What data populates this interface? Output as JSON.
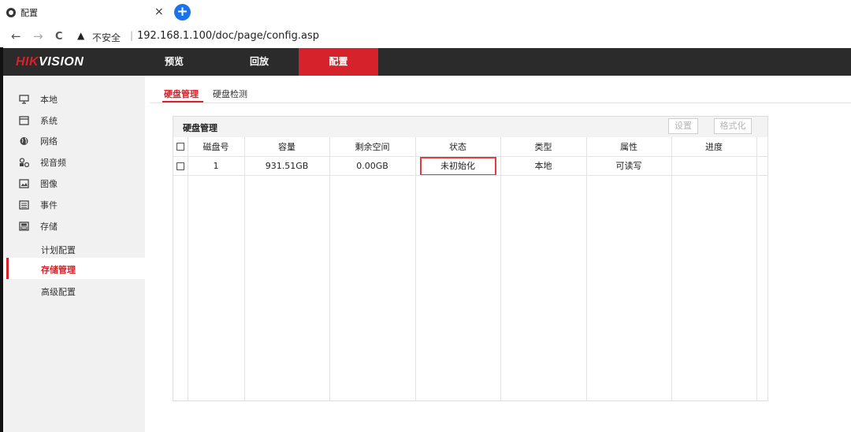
{
  "browser": {
    "tab_title": "配置",
    "close_glyph": "×",
    "newtab_glyph": "+",
    "back_glyph": "←",
    "forward_glyph": "→",
    "reload_glyph": "C",
    "warning_glyph": "▲",
    "insecure_label": "不安全",
    "separator": "|",
    "url": "192.168.1.100/doc/page/config.asp"
  },
  "header": {
    "logo_red": "HIK",
    "logo_white": "VISION",
    "nav": [
      "预览",
      "回放",
      "配置"
    ],
    "active_nav": "配置",
    "colors": {
      "bar": "#2b2b2b",
      "accent": "#d6232b"
    }
  },
  "sidebar": {
    "items": [
      {
        "label": "本地",
        "icon": "monitor-icon"
      },
      {
        "label": "系统",
        "icon": "window-icon"
      },
      {
        "label": "网络",
        "icon": "globe-icon"
      },
      {
        "label": "视音频",
        "icon": "media-icon"
      },
      {
        "label": "图像",
        "icon": "image-icon"
      },
      {
        "label": "事件",
        "icon": "calendar-icon"
      },
      {
        "label": "存储",
        "icon": "storage-icon"
      }
    ],
    "sub_items": [
      {
        "label": "计划配置"
      },
      {
        "label": "存储管理",
        "active": true
      },
      {
        "label": "高级配置"
      }
    ]
  },
  "content": {
    "tabs": [
      "硬盘管理",
      "硬盘检测"
    ],
    "active_tab": "硬盘管理",
    "panel": {
      "title": "硬盘管理",
      "buttons": {
        "settings": "设置",
        "format": "格式化"
      },
      "columns": [
        "磁盘号",
        "容量",
        "剩余空间",
        "状态",
        "类型",
        "属性",
        "进度"
      ],
      "rows": [
        {
          "disk_no": "1",
          "capacity": "931.51GB",
          "free_space": "0.00GB",
          "status": "未初始化",
          "type": "本地",
          "attribute": "可读写",
          "progress": ""
        }
      ]
    }
  }
}
